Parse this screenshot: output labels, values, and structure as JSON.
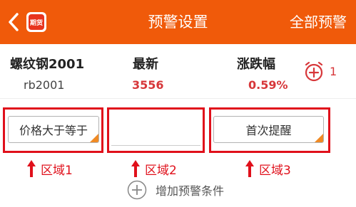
{
  "header": {
    "app_badge": "期货",
    "title": "预警设置",
    "right_action": "全部预警",
    "accent_color": "#f05a0a"
  },
  "quote": {
    "columns": [
      "螺纹钢2001",
      "最新",
      "涨跌幅"
    ],
    "symbol_code": "rb2001",
    "latest_value": "3556",
    "change_value": "0.59%",
    "alert_count": "1",
    "value_color": "#d7373a"
  },
  "condition": {
    "operator": "价格大于等于",
    "value": "",
    "frequency": "首次提醒"
  },
  "annotations": {
    "region_labels": [
      "区域1",
      "区域2",
      "区域3"
    ],
    "highlight_color": "#e0101b"
  },
  "add_condition_label": "增加预警条件",
  "icons": [
    "back-icon",
    "add-alert-icon",
    "up-arrow-icon",
    "plus-circle-icon"
  ]
}
